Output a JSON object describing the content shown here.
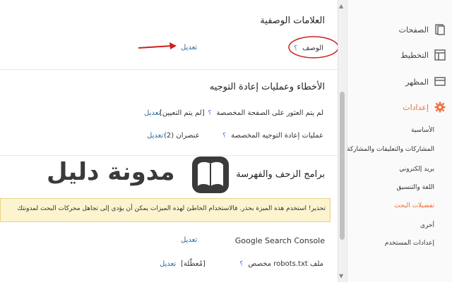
{
  "meta_tags": {
    "title": "العلامات الوصفية",
    "description_label": "الوصف",
    "help_mark": "؟",
    "edit": "تعديل"
  },
  "errors": {
    "title": "الأخطاء وعمليات إعادة التوجيه",
    "row1_label": "لم يتم العثور على الصفحة المخصصة",
    "row1_help": "؟",
    "row1_value": "[لم يتم التعيين]",
    "row1_edit": "تعديل",
    "row2_label": "عمليات إعادة التوجيه المخصصة",
    "row2_help": "؟",
    "row2_value": "عنصران (2)",
    "row2_edit": "تعديل"
  },
  "crawlers": {
    "title": "برامج الزحف والفهرسة",
    "warning": "تحذير! استخدم هذه الميزة بحذر. فالاستخدام الخاطئ لهذه الميزات يمكن أن يؤدي إلى تجاهل محركات البحث لمدونتك",
    "gsc_label": "Google Search Console",
    "gsc_edit": "تعديل",
    "robots_label": "ملف robots.txt مخصص",
    "robots_help": "؟",
    "robots_value": "[مُعطّلة]",
    "robots_edit": "تعديل"
  },
  "watermark": {
    "text": "مدونة دليل"
  },
  "sidebar": {
    "pages": "الصفحات",
    "layout": "التخطيط",
    "theme": "المظهر",
    "settings": "إعدادات",
    "sub": {
      "basic": "الأساسية",
      "posts": "المشاركات والتعليقات والمشاركة",
      "email": "بريد إلكتروني",
      "language": "اللغة والتنسيق",
      "search": "تفضيلات البحث",
      "other": "أخرى",
      "user": "إعدادات المستخدم"
    }
  },
  "colors": {
    "accent": "#f06a35",
    "link": "#2a6a9e",
    "annotation": "#cc1f1f",
    "warning_bg": "#fcf3cf"
  }
}
